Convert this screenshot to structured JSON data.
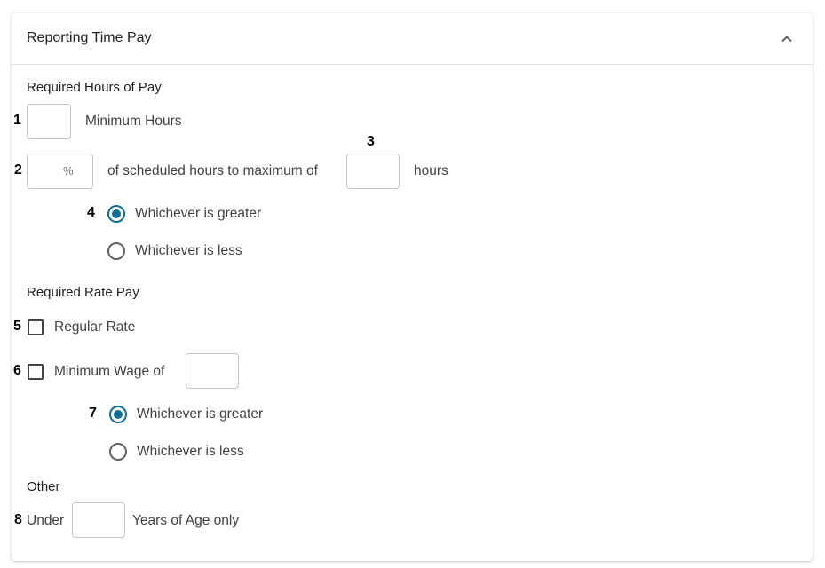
{
  "card": {
    "title": "Reporting Time Pay",
    "collapse_icon": "chevron-up-icon"
  },
  "required_hours": {
    "title": "Required Hours of Pay",
    "minimum_hours": {
      "value": "",
      "label": "Minimum Hours"
    },
    "percent": {
      "value": "",
      "placeholder": "%",
      "label": "of scheduled hours to maximum of"
    },
    "max_hours": {
      "value": "",
      "label": "hours"
    },
    "options": [
      {
        "label": "Whichever is greater",
        "selected": true
      },
      {
        "label": "Whichever is less",
        "selected": false
      }
    ]
  },
  "required_rate": {
    "title": "Required Rate Pay",
    "regular_rate": {
      "label": "Regular Rate",
      "checked": false
    },
    "minimum_wage": {
      "label": "Minimum Wage of",
      "checked": false,
      "value": ""
    },
    "options": [
      {
        "label": "Whichever is greater",
        "selected": true
      },
      {
        "label": "Whichever is less",
        "selected": false
      }
    ]
  },
  "other": {
    "title": "Other",
    "under_label": "Under",
    "age_value": "",
    "age_label": "Years of Age only"
  },
  "markers": [
    "1",
    "2",
    "3",
    "4",
    "5",
    "6",
    "7",
    "8"
  ],
  "colors": {
    "accent": "#0b6f96",
    "border": "#c4c4c4",
    "text": "#424242"
  }
}
